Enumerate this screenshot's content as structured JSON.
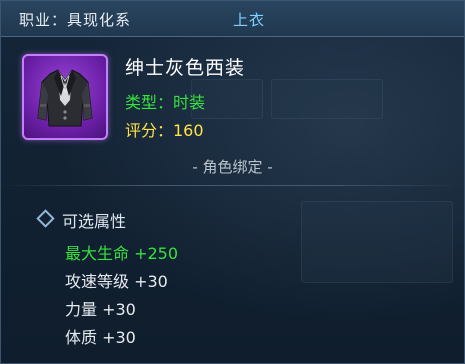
{
  "header": {
    "class_label": "职业：具现化系",
    "slot_label": "上衣"
  },
  "item": {
    "icon": "black-suit-jacket-icon",
    "rarity_color": "#9a46d8",
    "name": "绅士灰色西装",
    "type_line": "类型：时装",
    "score_line": "评分：160",
    "bind_line": "- 角色绑定 -"
  },
  "attributes": {
    "title": "可选属性",
    "items": [
      {
        "text": "最大生命 +250",
        "highlight": true
      },
      {
        "text": "攻速等级 +30",
        "highlight": false
      },
      {
        "text": "力量 +30",
        "highlight": false
      },
      {
        "text": "体质 +30",
        "highlight": false
      }
    ]
  },
  "colors": {
    "type_green": "#36e23e",
    "score_yellow": "#ffe14a",
    "slot_blue": "#7fd0ff"
  }
}
